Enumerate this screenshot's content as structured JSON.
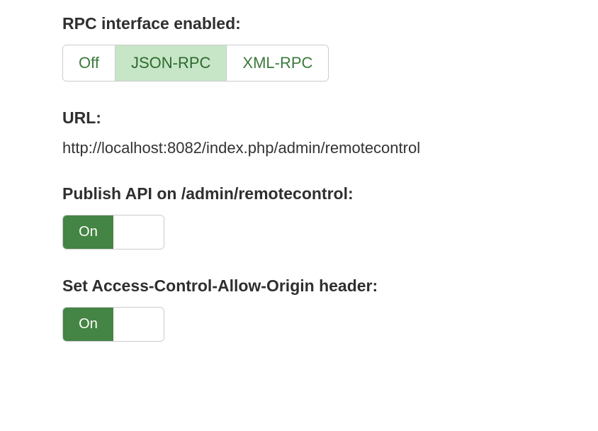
{
  "rpc_interface": {
    "label": "RPC interface enabled:",
    "options": [
      "Off",
      "JSON-RPC",
      "XML-RPC"
    ],
    "selected": "JSON-RPC"
  },
  "url": {
    "label": "URL:",
    "value": "http://localhost:8082/index.php/admin/remotecontrol"
  },
  "publish_api": {
    "label": "Publish API on /admin/remotecontrol:",
    "state_label": "On"
  },
  "cors_header": {
    "label": "Set Access-Control-Allow-Origin header:",
    "state_label": "On"
  }
}
